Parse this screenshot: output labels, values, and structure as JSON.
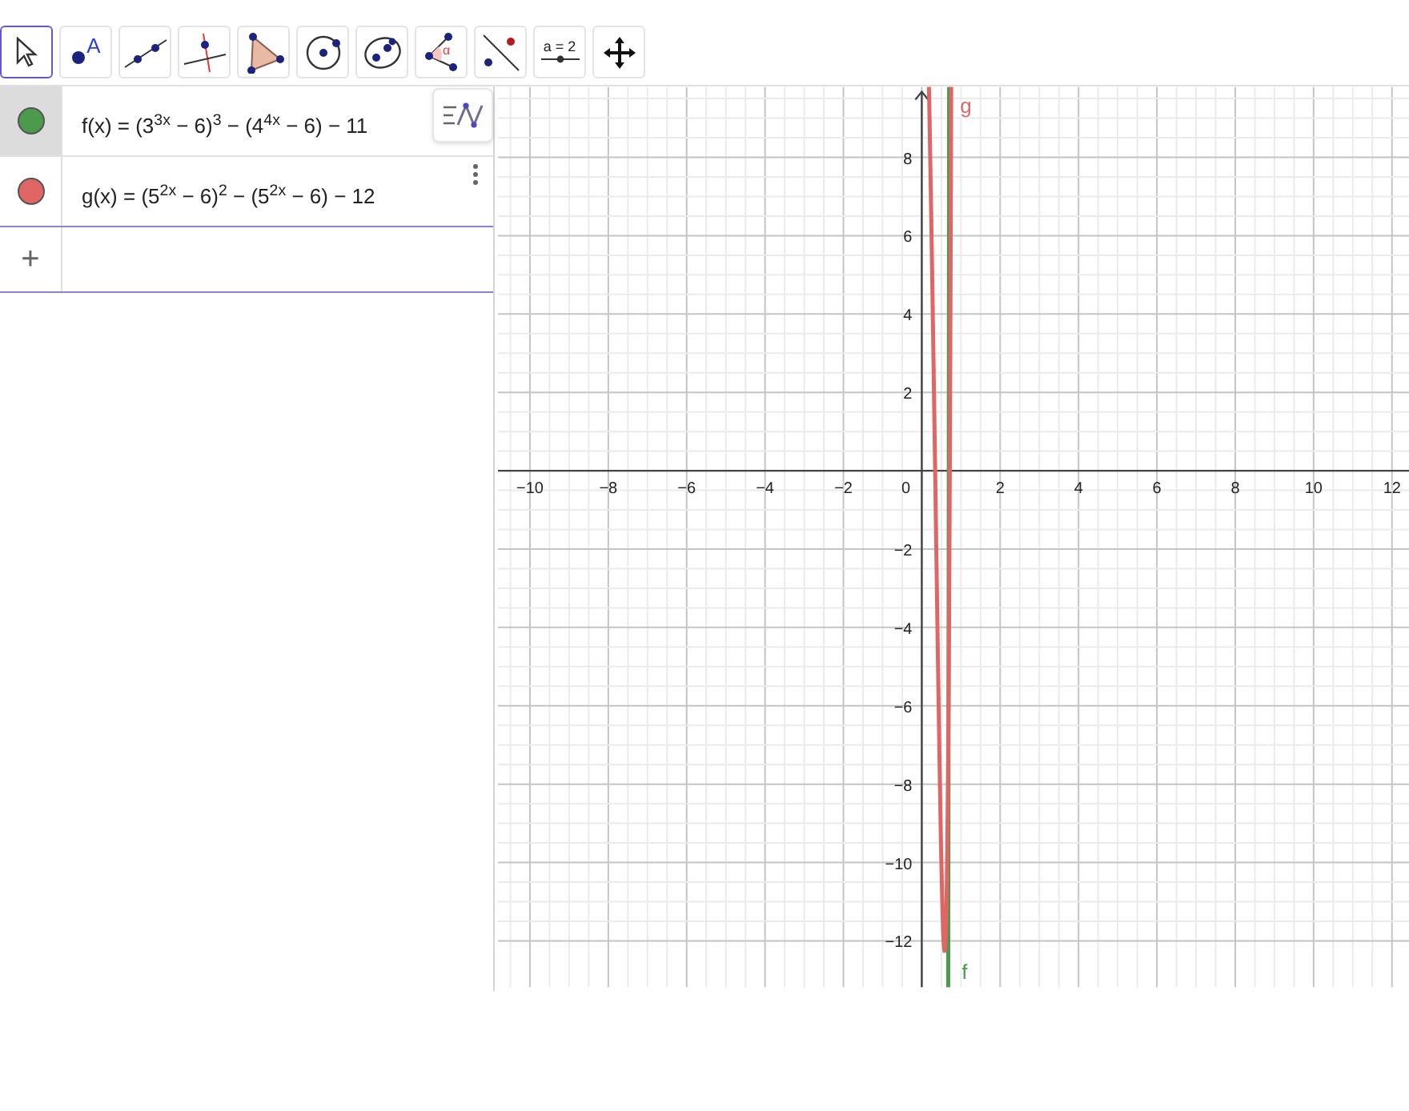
{
  "toolbar": [
    {
      "kind": "move",
      "selected": true
    },
    {
      "kind": "point",
      "selected": false,
      "label": "A"
    },
    {
      "kind": "line",
      "selected": false
    },
    {
      "kind": "perpendicular",
      "selected": false
    },
    {
      "kind": "polygon",
      "selected": false
    },
    {
      "kind": "circle",
      "selected": false
    },
    {
      "kind": "conic",
      "selected": false
    },
    {
      "kind": "angle",
      "selected": false,
      "label": "α"
    },
    {
      "kind": "reflect",
      "selected": false
    },
    {
      "kind": "slider",
      "selected": false,
      "label": "a = 2"
    },
    {
      "kind": "move-view",
      "selected": false
    }
  ],
  "algebra": {
    "rows": [
      {
        "expression": "f(x) = (3$^{3x}$ − 6)$^{3}$ − (4$^{4x}$ − 6) − 11",
        "color": "#4c9a4c",
        "selected": true
      },
      {
        "expression": "g(x) = (5$^{2x}$ − 6)$^{2}$ − (5$^{2x}$ − 6) − 12",
        "color": "#e06666",
        "selected": false
      }
    ],
    "input_symbol": "+"
  },
  "graphics": {
    "x_ticks": [
      "−10",
      "−8",
      "−6",
      "−4",
      "−2",
      "0",
      "2",
      "4",
      "6",
      "8",
      "10",
      "12"
    ],
    "y_ticks": [
      "8",
      "6",
      "4",
      "2",
      "−2",
      "−4",
      "−6",
      "−8",
      "−10",
      "−12"
    ],
    "curve_labels": [
      {
        "text": "g",
        "color": "#e06666"
      },
      {
        "text": "f",
        "color": "#4c9a4c"
      }
    ]
  }
}
